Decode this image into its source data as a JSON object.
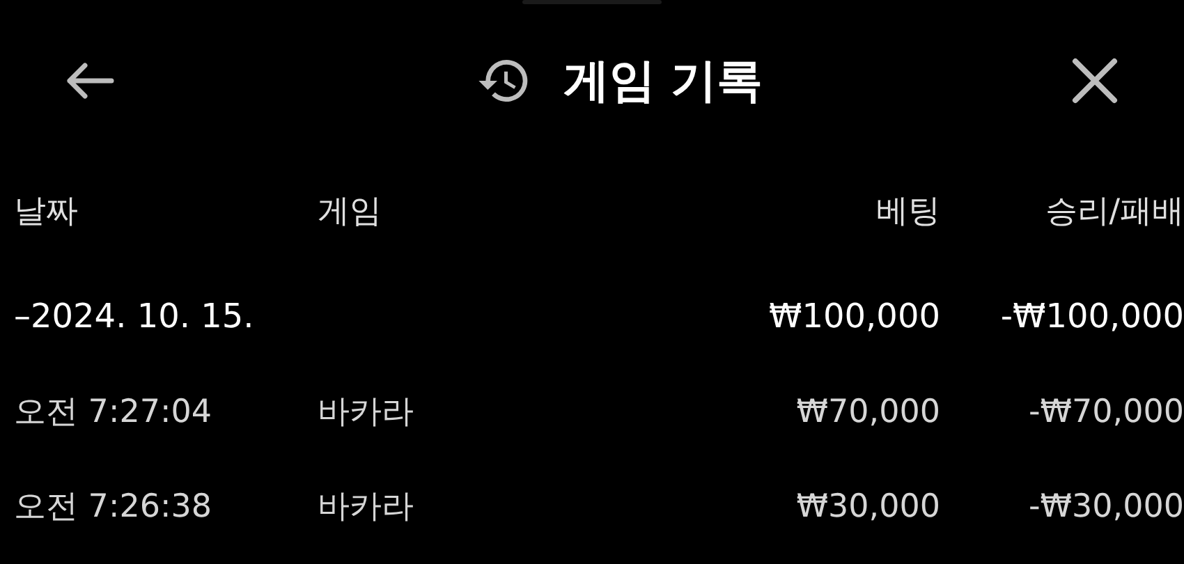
{
  "header": {
    "title": "게임 기록"
  },
  "table": {
    "columns": [
      "날짜",
      "게임",
      "베팅",
      "승리/패배"
    ],
    "groups": [
      {
        "toggle": "–",
        "date": "2024. 10. 15.",
        "bet": "₩100,000",
        "result": "-₩100,000",
        "expanded": true,
        "rows": [
          {
            "time": "오전 7:27:04",
            "game": "바카라",
            "bet": "₩70,000",
            "result": "-₩70,000"
          },
          {
            "time": "오전 7:26:38",
            "game": "바카라",
            "bet": "₩30,000",
            "result": "-₩30,000"
          }
        ]
      }
    ]
  }
}
